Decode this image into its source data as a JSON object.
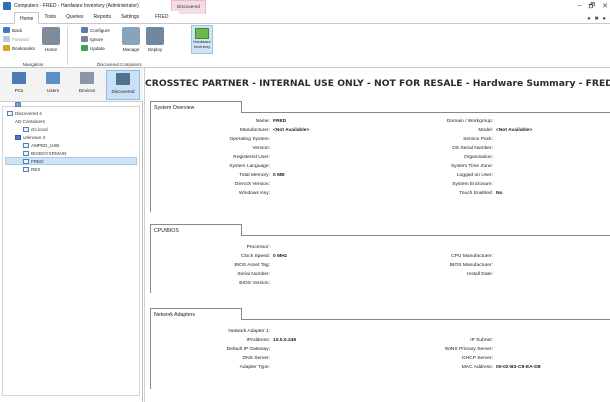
{
  "window": {
    "title": "Computers - FRED - Hardware Inventory (Administrator)",
    "context_tab": "Discovered",
    "controls": [
      "–",
      "🗗",
      "✕"
    ]
  },
  "ribbon": {
    "tabs": [
      "Home",
      "Tools",
      "Queries",
      "Reports",
      "Settings",
      "FRED"
    ],
    "navigation": {
      "back": "Back",
      "forward": "Forward",
      "home": "Home",
      "bookmarks": "Bookmarks",
      "label": "Navigation"
    },
    "discovered": {
      "configure": "Configure",
      "ignore": "Ignore",
      "update": "Update",
      "manage": "Manage",
      "deploy": "Deploy",
      "label": "Discovered Computers"
    },
    "hardware_inventory": "Hardware Inventory"
  },
  "nav": {
    "items": [
      "PCs",
      "Users",
      "Devices",
      "Discovered"
    ]
  },
  "tree": {
    "nodes": [
      "Discovered 4",
      "AD Containers",
      "ctc.local",
      "unknown 4",
      "AMPED_USB",
      "BIGBOYXRMAIN",
      "FRED",
      "REX"
    ]
  },
  "main": {
    "header": "CROSSTEC PARTNER - INTERNAL USE ONLY - NOT FOR RESALE - Hardware Summary - FRED",
    "system_overview": {
      "tab": "System Overview",
      "left": [
        {
          "label": "Name:",
          "value": "FRED"
        },
        {
          "label": "Manufacturer:",
          "value": "<Not Available>"
        },
        {
          "label": "Operating System:",
          "value": ""
        },
        {
          "label": "Version:",
          "value": ""
        },
        {
          "label": "Registered User:",
          "value": ""
        },
        {
          "label": "System Language:",
          "value": ""
        },
        {
          "label": "Total Memory:",
          "value": "0 MB"
        },
        {
          "label": "DirectX Version:",
          "value": ""
        },
        {
          "label": "Windows Key:",
          "value": ""
        }
      ],
      "right": [
        {
          "label": "Domain / Workgroup:",
          "value": ""
        },
        {
          "label": "Model:",
          "value": "<Not Available>"
        },
        {
          "label": "Service Pack:",
          "value": ""
        },
        {
          "label": "OS Serial Number:",
          "value": ""
        },
        {
          "label": "Organisation:",
          "value": ""
        },
        {
          "label": "System Time Zone:",
          "value": ""
        },
        {
          "label": "Logged on User:",
          "value": ""
        },
        {
          "label": "System Enclosure:",
          "value": ""
        },
        {
          "label": "Touch Enabled:",
          "value": "No"
        }
      ]
    },
    "cpu_bios": {
      "tab": "CPU\\BIOS",
      "left": [
        {
          "label": "Processor:",
          "value": ""
        },
        {
          "label": "Clock Speed:",
          "value": "0 MHz"
        },
        {
          "label": "BIOS Asset Tag:",
          "value": ""
        },
        {
          "label": "Serial Number:",
          "value": ""
        },
        {
          "label": "BIOS Version:",
          "value": ""
        }
      ],
      "right": [
        {
          "label": "CPU Manufacturer:",
          "value": ""
        },
        {
          "label": "BIOS Manufacturer:",
          "value": ""
        },
        {
          "label": "Install Date:",
          "value": ""
        }
      ]
    },
    "network": {
      "tab": "Network Adapters",
      "left": [
        {
          "label": "Network Adapter 1:",
          "value": ""
        },
        {
          "label": "IPAddress:",
          "value": "10.0.0.249"
        },
        {
          "label": "Default IP Gateway:",
          "value": ""
        },
        {
          "label": "DNS Server:",
          "value": ""
        },
        {
          "label": "Adapter Type:",
          "value": ""
        }
      ],
      "right": [
        {
          "label": "IP Subnet:",
          "value": ""
        },
        {
          "label": "WINS Primary Server:",
          "value": ""
        },
        {
          "label": "DHCP Server:",
          "value": ""
        },
        {
          "label": "MAC Address:",
          "value": "00-02-B3-C8-EA-D8"
        }
      ]
    }
  }
}
